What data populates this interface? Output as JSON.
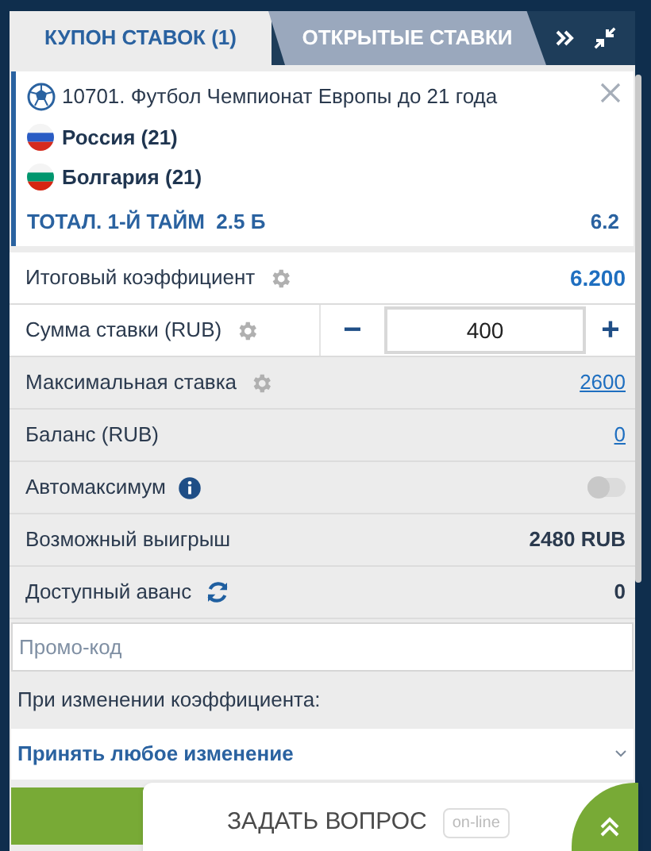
{
  "tabs": [
    {
      "label": "КУПОН СТАВОК (1)",
      "selected": true
    },
    {
      "label": "ОТКРЫТЫЕ СТАВКИ",
      "selected": false
    }
  ],
  "event": {
    "title": "10701. Футбол Чемпионат Европы до 21 года",
    "teams": [
      {
        "name": "Россия (21)",
        "kind": "russia"
      },
      {
        "name": "Болгария (21)",
        "kind": "bulgaria"
      }
    ],
    "market": "ТОТАЛ. 1-Й ТАЙМ  2.5 Б",
    "odds": "6.2"
  },
  "rows": [
    {
      "kind": "value",
      "label": "Итоговый коэффициент",
      "value": "6.200"
    },
    {
      "kind": "stepper",
      "label": "Сумма ставки (RUB)",
      "minus": "−",
      "value": "400",
      "plus": "+"
    },
    {
      "kind": "link",
      "label": "Максимальная ставка",
      "value": "2600"
    },
    {
      "kind": "link",
      "label": "Баланс (RUB)",
      "value": "0"
    },
    {
      "kind": "toggle",
      "label": "Автомаксимум",
      "on": false
    },
    {
      "kind": "text",
      "label": "Возможный выигрыш",
      "value": "2480 RUB"
    },
    {
      "kind": "text",
      "label": "Доступный аванс",
      "value": "0"
    }
  ],
  "promo": {
    "placeholder": "Промо-код"
  },
  "odds_change": {
    "label": "При изменении коэффициента:",
    "value": "Принять любое изменение"
  },
  "chat": {
    "label": "ЗАДАТЬ ВОПРОС",
    "badge": "on-line"
  }
}
